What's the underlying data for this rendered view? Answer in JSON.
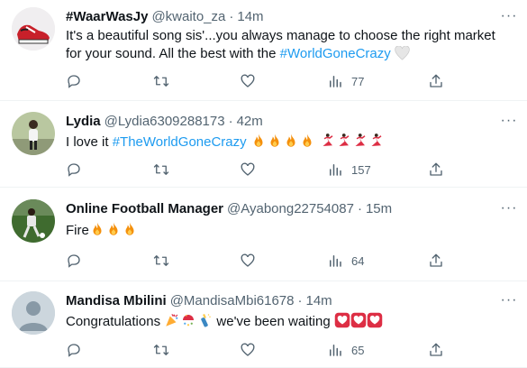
{
  "tweets": [
    {
      "name": "#WaarWasJy",
      "handle": "@kwaito_za",
      "time": "14m",
      "text_before": "It's a beautiful song sis'...you always manage to choose the right market for your sound. All the best with the ",
      "hashtag": "#WorldGoneCrazy",
      "text_after": "",
      "emojis": [
        "white-heart"
      ],
      "views": "77"
    },
    {
      "name": "Lydia",
      "handle": "@Lydia6309288173",
      "time": "42m",
      "text_before": "I love it ",
      "hashtag": "#TheWorldGoneCrazy",
      "text_after": "",
      "emojis": [
        "fire",
        "fire",
        "fire",
        "fire",
        "dancer",
        "dancer",
        "dancer",
        "dancer"
      ],
      "views": "157"
    },
    {
      "name": "Online Football Manager",
      "handle": "@Ayabong22754087",
      "time": "15m",
      "text_before": "Fire",
      "hashtag": "",
      "text_after": "",
      "emojis": [
        "fire",
        "fire",
        "fire"
      ],
      "views": "64"
    },
    {
      "name": "Mandisa Mbilini",
      "handle": "@MandisaMbi61678",
      "time": "14m",
      "text_before": "Congratulations ",
      "hashtag": "",
      "text_after": " we've been waiting ",
      "emojis_mid": [
        "party-popper",
        "confetti-ball",
        "champagne"
      ],
      "emojis": [
        "heart-box",
        "heart-box",
        "heart-box"
      ],
      "views": "65"
    }
  ],
  "colors": {
    "accent": "#1d9bf0",
    "muted": "#536471",
    "text": "#0f1419"
  }
}
